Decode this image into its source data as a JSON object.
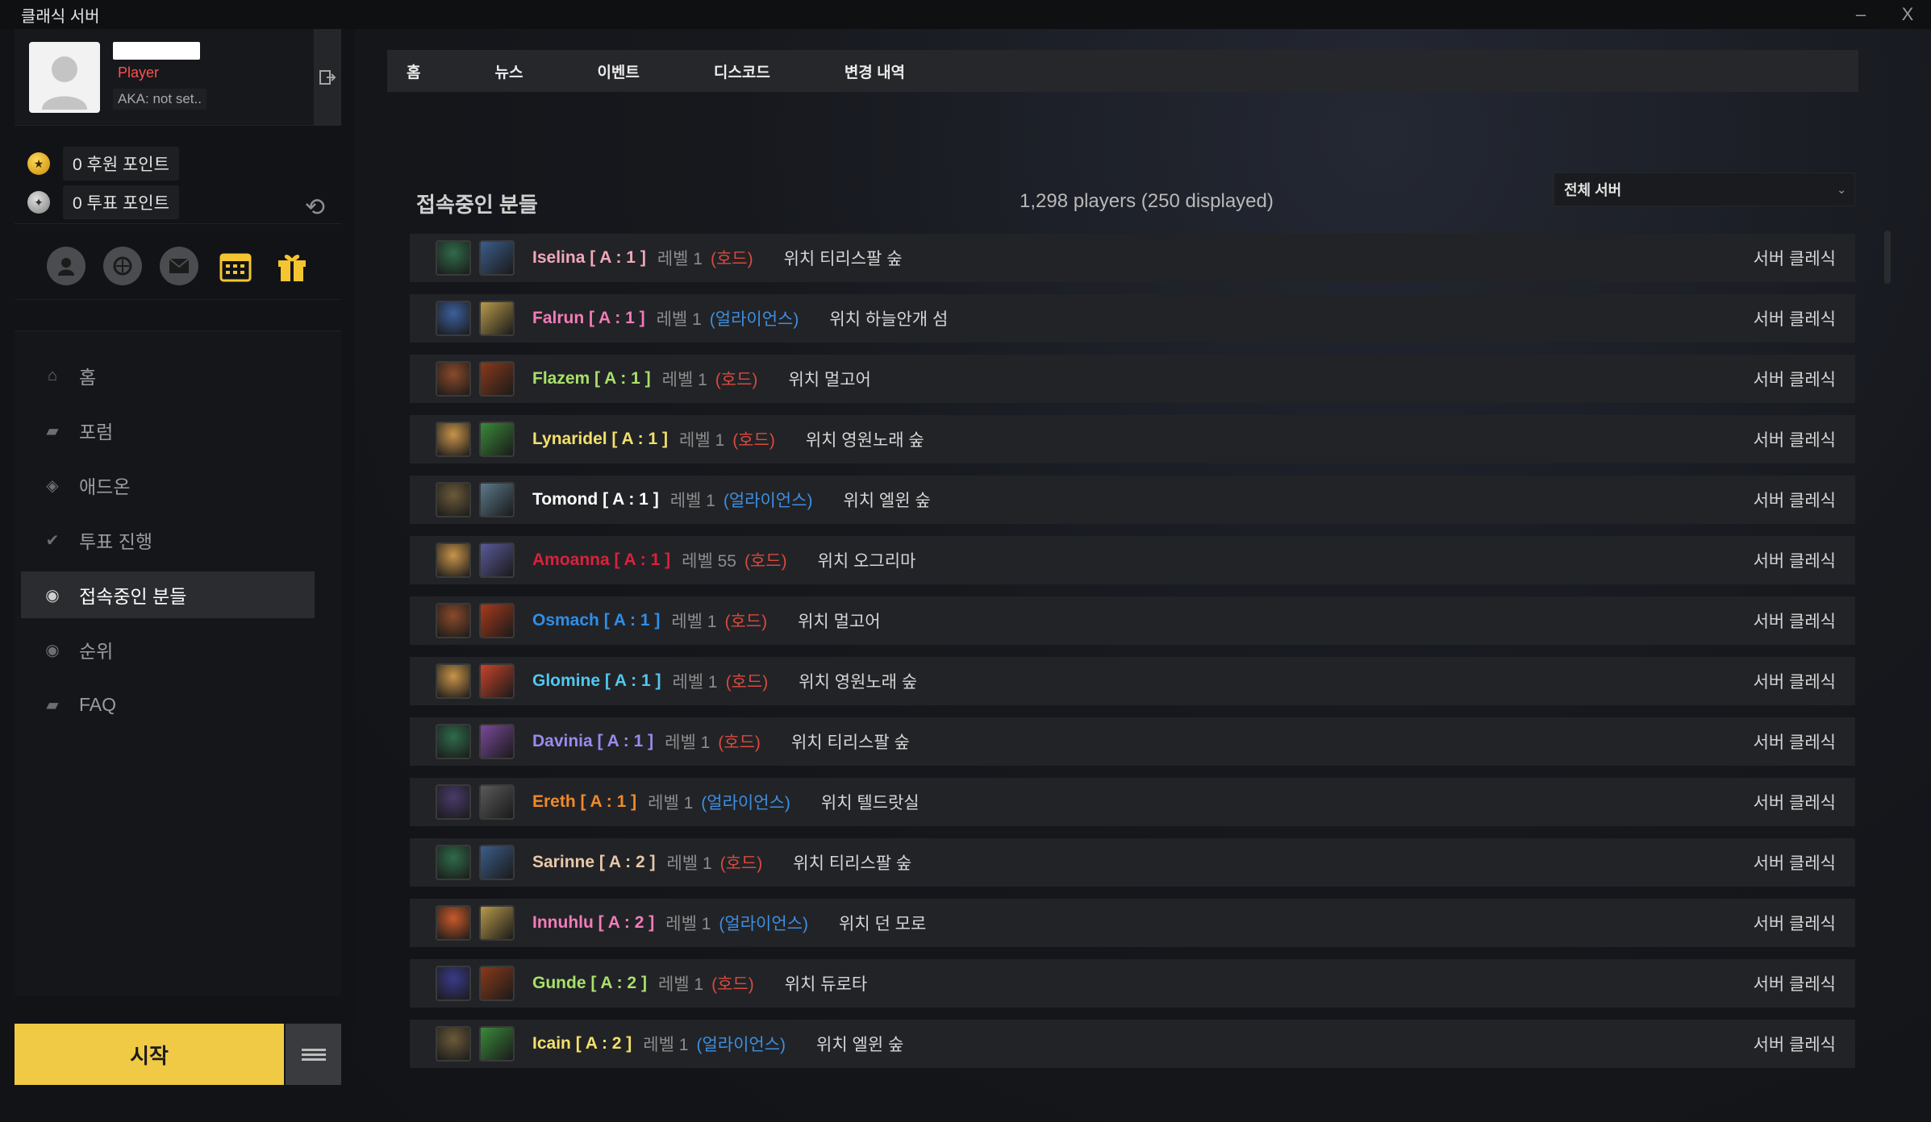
{
  "window": {
    "title": "클래식 서버",
    "minimize": "–",
    "close": "X"
  },
  "profile": {
    "role": "Player",
    "aka": "AKA: not set.."
  },
  "points": {
    "donation": "0 후원 포인트",
    "vote": "0 투표 포인트"
  },
  "quick_icons": [
    "account-icon",
    "armory-icon",
    "mail-icon",
    "calendar-icon",
    "gift-icon"
  ],
  "nav": [
    {
      "label": "홈",
      "icon": "home-icon"
    },
    {
      "label": "포럼",
      "icon": "forum-icon"
    },
    {
      "label": "애드온",
      "icon": "addon-icon"
    },
    {
      "label": "투표 진행",
      "icon": "vote-icon"
    },
    {
      "label": "접속중인 분들",
      "icon": "online-icon",
      "active": true
    },
    {
      "label": "순위",
      "icon": "ranking-icon"
    },
    {
      "label": "FAQ",
      "icon": "faq-icon"
    }
  ],
  "start_button": "시작",
  "tabs": [
    "홈",
    "뉴스",
    "이벤트",
    "디스코드",
    "변경 내역"
  ],
  "online": {
    "title": "접속중인 분들",
    "count": "1,298 players (250 displayed)",
    "server_filter": "전체 서버"
  },
  "colors": {
    "accent": "#f1ca45",
    "horde": "#d84a3d",
    "alliance": "#3d8fe0"
  },
  "players": [
    {
      "name": "Iselina [ A : 1 ]",
      "name_color": "#f0a8b8",
      "level": "레벨 1",
      "faction": "(호드)",
      "faction_type": "horde",
      "location": "위치 티리스팔 숲",
      "server": "서버 클레식",
      "portrait_color": "#2f6b4a",
      "class_color": "#3b5d8a"
    },
    {
      "name": "Falrun [ A : 1 ]",
      "name_color": "#f27cb8",
      "level": "레벨 1",
      "faction": "(얼라이언스)",
      "faction_type": "alliance",
      "location": "위치 하늘안개 섬",
      "server": "서버 클레식",
      "portrait_color": "#3c5f9c",
      "class_color": "#b89a4a"
    },
    {
      "name": "Flazem [ A : 1 ]",
      "name_color": "#a8e06a",
      "level": "레벨 1",
      "faction": "(호드)",
      "faction_type": "horde",
      "location": "위치 멀고어",
      "server": "서버 클레식",
      "portrait_color": "#8a4a2a",
      "class_color": "#8a3a1a"
    },
    {
      "name": "Lynaridel [ A : 1 ]",
      "name_color": "#f3e06a",
      "level": "레벨 1",
      "faction": "(호드)",
      "faction_type": "horde",
      "location": "위치 영원노래 숲",
      "server": "서버 클레식",
      "portrait_color": "#c8944a",
      "class_color": "#3a8a3a"
    },
    {
      "name": "Tomond [ A : 1 ]",
      "name_color": "#ffffff",
      "level": "레벨 1",
      "faction": "(얼라이언스)",
      "faction_type": "alliance",
      "location": "위치 엘윈 숲",
      "server": "서버 클레식",
      "portrait_color": "#6a5a3a",
      "class_color": "#5a7a8a"
    },
    {
      "name": "Amoanna [ A : 1 ]",
      "name_color": "#d8223a",
      "level": "레벨 55",
      "faction": "(호드)",
      "faction_type": "horde",
      "location": "위치 오그리마",
      "server": "서버 클레식",
      "portrait_color": "#c8944a",
      "class_color": "#5a5a9a"
    },
    {
      "name": "Osmach [ A : 1 ]",
      "name_color": "#2e8fe8",
      "level": "레벨 1",
      "faction": "(호드)",
      "faction_type": "horde",
      "location": "위치 멀고어",
      "server": "서버 클레식",
      "portrait_color": "#8a4a2a",
      "class_color": "#a83a1a"
    },
    {
      "name": "Glomine [ A : 1 ]",
      "name_color": "#4fc8f0",
      "level": "레벨 1",
      "faction": "(호드)",
      "faction_type": "horde",
      "location": "위치 영원노래 숲",
      "server": "서버 클레식",
      "portrait_color": "#c8944a",
      "class_color": "#c8442a"
    },
    {
      "name": "Davinia [ A : 1 ]",
      "name_color": "#9a8af0",
      "level": "레벨 1",
      "faction": "(호드)",
      "faction_type": "horde",
      "location": "위치 티리스팔 숲",
      "server": "서버 클레식",
      "portrait_color": "#2f6b4a",
      "class_color": "#7a4a9a"
    },
    {
      "name": "Ereth [ A : 1 ]",
      "name_color": "#f08a2a",
      "level": "레벨 1",
      "faction": "(얼라이언스)",
      "faction_type": "alliance",
      "location": "위치 텔드랏실",
      "server": "서버 클레식",
      "portrait_color": "#4a3a6a",
      "class_color": "#5a5a5a"
    },
    {
      "name": "Sarinne [ A : 2 ]",
      "name_color": "#e8c8a8",
      "level": "레벨 1",
      "faction": "(호드)",
      "faction_type": "horde",
      "location": "위치 티리스팔 숲",
      "server": "서버 클레식",
      "portrait_color": "#2f6b4a",
      "class_color": "#3b5d8a"
    },
    {
      "name": "Innuhlu [ A : 2 ]",
      "name_color": "#f27cb8",
      "level": "레벨 1",
      "faction": "(얼라이언스)",
      "faction_type": "alliance",
      "location": "위치 던 모로",
      "server": "서버 클레식",
      "portrait_color": "#c85a2a",
      "class_color": "#b89a4a"
    },
    {
      "name": "Gunde [ A : 2 ]",
      "name_color": "#a8e06a",
      "level": "레벨 1",
      "faction": "(호드)",
      "faction_type": "horde",
      "location": "위치 듀로타",
      "server": "서버 클레식",
      "portrait_color": "#3a3a8a",
      "class_color": "#8a3a1a"
    },
    {
      "name": "Icain [ A : 2 ]",
      "name_color": "#f3e06a",
      "level": "레벨 1",
      "faction": "(얼라이언스)",
      "faction_type": "alliance",
      "location": "위치 엘윈 숲",
      "server": "서버 클레식",
      "portrait_color": "#6a5a3a",
      "class_color": "#3a8a3a"
    }
  ]
}
